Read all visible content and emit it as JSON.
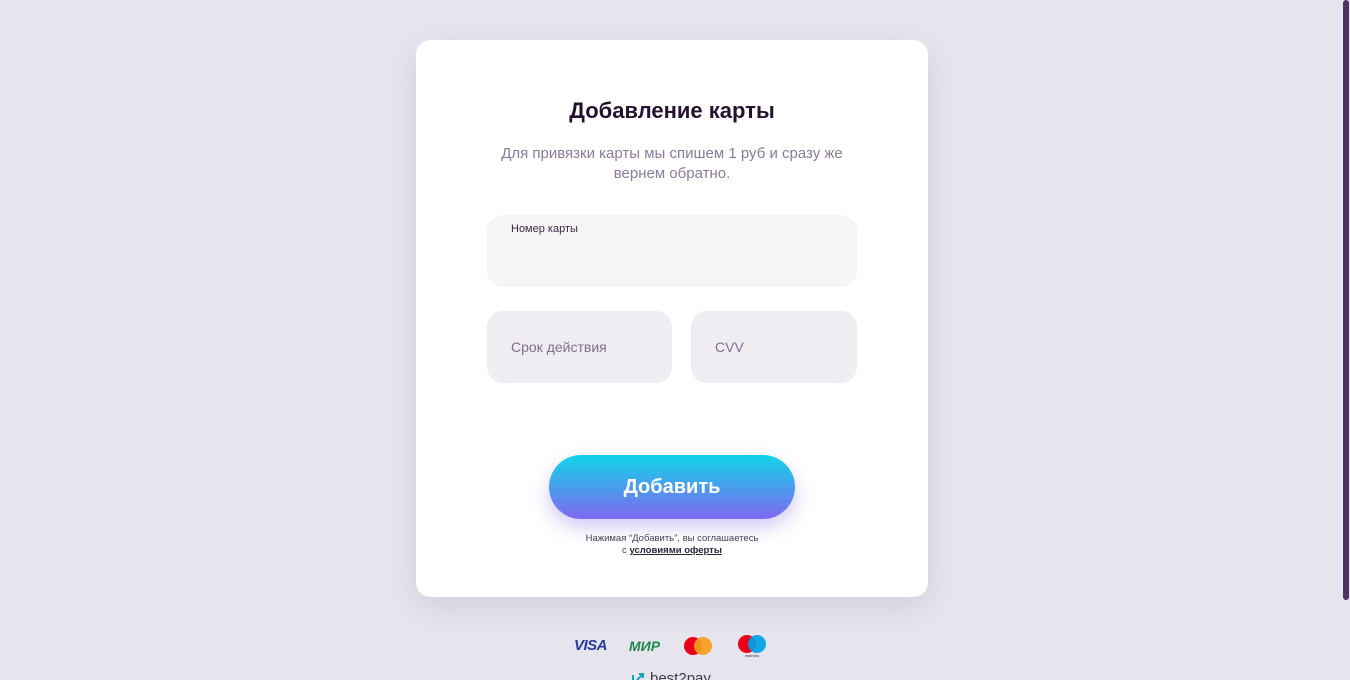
{
  "form": {
    "title": "Добавление карты",
    "subtitle": "Для привязки карты мы спишем 1 руб и сразу же вернем обратно.",
    "card_number": {
      "label": "Номер карты",
      "value": ""
    },
    "expiry": {
      "placeholder": "Срок действия"
    },
    "cvv": {
      "placeholder": "CVV"
    },
    "submit_label": "Добавить",
    "agree_text_1": "Нажимая “Добавить”, вы соглашаетесь",
    "agree_text_2": "с",
    "agree_link": "условиями оферты"
  },
  "payment_logos": {
    "visa": "VISA",
    "mir": "МИР",
    "maestro_caption": "maestro"
  },
  "brand": "best2pay",
  "colors": {
    "background": "#e6e5ee",
    "button_gradient_top": "#11d4e6",
    "button_gradient_bottom": "#8067f2",
    "title": "#24122f",
    "subtitle": "#8a7a9b"
  }
}
